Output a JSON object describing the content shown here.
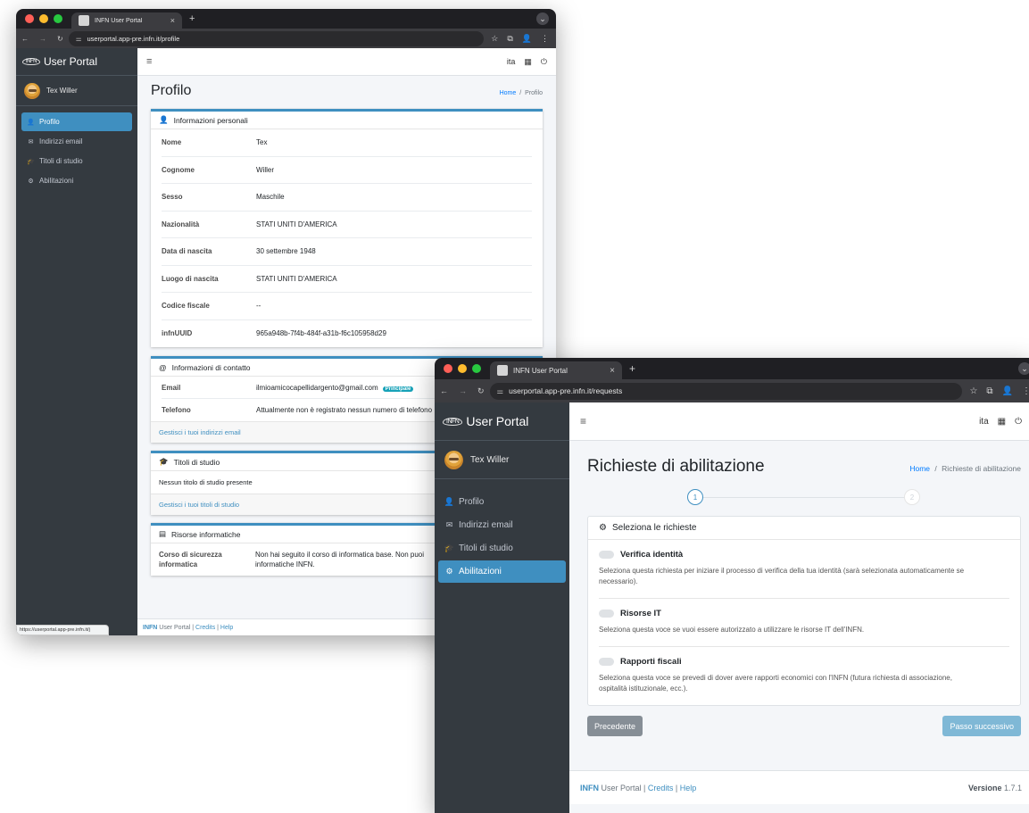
{
  "window1": {
    "tab_title": "INFN User Portal",
    "tab_close": "×",
    "new_tab": "+",
    "url": "userportal.app-pre.infn.it/profile",
    "sidebar": {
      "brand_logo": "INFN",
      "brand_text": "User Portal",
      "user_name": "Tex Willer",
      "items": [
        {
          "icon": "user-icon",
          "glyph": "👤",
          "label": "Profilo",
          "active": true
        },
        {
          "icon": "envelope-icon",
          "glyph": "✉",
          "label": "Indirizzi email",
          "active": false
        },
        {
          "icon": "graduation-cap-icon",
          "glyph": "🎓",
          "label": "Titoli di studio",
          "active": false
        },
        {
          "icon": "cogs-icon",
          "glyph": "⚙",
          "label": "Abilitazioni",
          "active": false
        }
      ]
    },
    "topnav": {
      "lang": "ita"
    },
    "page_title": "Profilo",
    "breadcrumb": {
      "home": "Home",
      "sep": "/",
      "current": "Profilo"
    },
    "personal": {
      "header": "Informazioni personali",
      "rows": [
        {
          "k": "Nome",
          "v": "Tex"
        },
        {
          "k": "Cognome",
          "v": "Willer"
        },
        {
          "k": "Sesso",
          "v": "Maschile"
        },
        {
          "k": "Nazionalità",
          "v": "STATI UNITI D'AMERICA"
        },
        {
          "k": "Data di nascita",
          "v": "30 settembre 1948"
        },
        {
          "k": "Luogo di nascita",
          "v": "STATI UNITI D'AMERICA"
        },
        {
          "k": "Codice fiscale",
          "v": "--"
        },
        {
          "k": "infnUUID",
          "v": "965a948b-7f4b-484f-a31b-f6c105958d29"
        }
      ]
    },
    "contact": {
      "header": "Informazioni di contatto",
      "email_label": "Email",
      "email_value": "ilmioamicocapellidargento@gmail.com",
      "email_badge": "Principale",
      "phone_label": "Telefono",
      "phone_value": "Attualmente non è registrato nessun numero di telefono",
      "manage_link": "Gestisci i tuoi indirizzi email"
    },
    "studies": {
      "header": "Titoli di studio",
      "empty_text": "Nessun titolo di studio presente",
      "manage_link": "Gestisci i tuoi titoli di studio"
    },
    "it_resources": {
      "header": "Risorse informatiche",
      "course_label": "Corso di sicurezza informatica",
      "course_value_1": "Non hai seguito il corso di informatica base. Non puoi",
      "course_value_2": "informatiche INFN."
    },
    "footer": {
      "brand": "INFN",
      "text": " User Portal | ",
      "credits": "Credits",
      "sep": " | ",
      "help": "Help"
    },
    "status_url": "https://userportal.app-pre.infn.it/j"
  },
  "window2": {
    "tab_title": "INFN User Portal",
    "tab_close": "×",
    "new_tab": "+",
    "url": "userportal.app-pre.infn.it/requests",
    "sidebar": {
      "brand_logo": "INFN",
      "brand_text": "User Portal",
      "user_name": "Tex Willer",
      "items": [
        {
          "icon": "user-icon",
          "glyph": "👤",
          "label": "Profilo",
          "active": false
        },
        {
          "icon": "envelope-icon",
          "glyph": "✉",
          "label": "Indirizzi email",
          "active": false
        },
        {
          "icon": "graduation-cap-icon",
          "glyph": "🎓",
          "label": "Titoli di studio",
          "active": false
        },
        {
          "icon": "cogs-icon",
          "glyph": "⚙",
          "label": "Abilitazioni",
          "active": true
        }
      ]
    },
    "topnav": {
      "lang": "ita"
    },
    "page_title": "Richieste di abilitazione",
    "breadcrumb": {
      "home": "Home",
      "sep": "/",
      "current": "Richieste di abilitazione"
    },
    "stepper": {
      "step1": "1",
      "step2": "2"
    },
    "card_header": "Seleziona le richieste",
    "options": [
      {
        "title": "Verifica identità",
        "desc_1": "Seleziona questa richiesta per iniziare il processo di verifica della tua identità (sarà selezionata automaticamente se",
        "desc_2": "necessario)."
      },
      {
        "title": "Risorse IT",
        "desc_1": "Seleziona questa voce se vuoi essere autorizzato a utilizzare le risorse IT dell'INFN.",
        "desc_2": ""
      },
      {
        "title": "Rapporti fiscali",
        "desc_1": "Seleziona questa voce se prevedi di dover avere rapporti economici con l'INFN (futura richiesta di associazione,",
        "desc_2": "ospitalità istituzionale, ecc.)."
      }
    ],
    "btn_prev": "Precedente",
    "btn_next": "Passo successivo",
    "footer": {
      "brand": "INFN",
      "text": " User Portal | ",
      "credits": "Credits",
      "sep": " | ",
      "help": "Help",
      "version_label": "Versione",
      "version": " 1.7.1"
    }
  },
  "colors": {
    "accent": "#3f8fc0",
    "sidebar": "#343a40",
    "badge": "#17a2b8"
  }
}
